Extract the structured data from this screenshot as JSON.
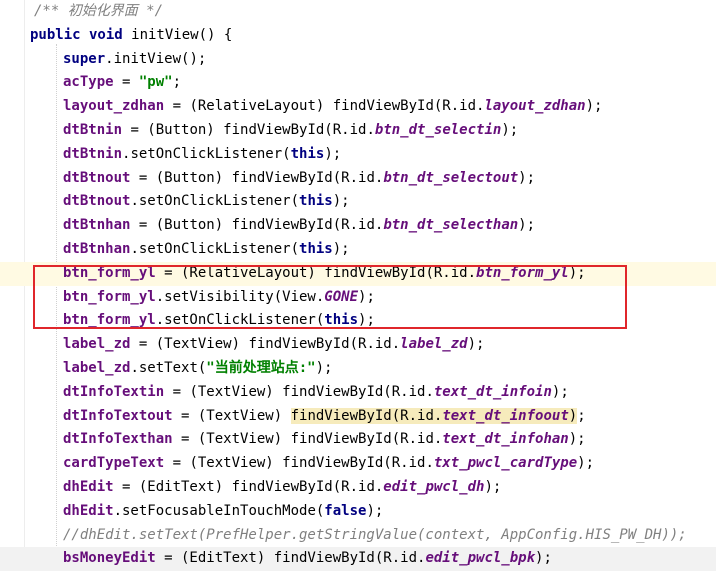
{
  "editor": {
    "lines": [
      [
        {
          "t": "/** 初始化界面 */",
          "c": "cm"
        }
      ],
      [
        {
          "t": "public void",
          "c": "kw"
        },
        {
          "t": " initView() {",
          "c": ""
        }
      ],
      [
        {
          "t": "super",
          "c": "kw"
        },
        {
          "t": ".initView();",
          "c": ""
        }
      ],
      [
        {
          "t": "acType",
          "c": "fld"
        },
        {
          "t": " = ",
          "c": ""
        },
        {
          "t": "\"pw\"",
          "c": "str"
        },
        {
          "t": ";",
          "c": ""
        }
      ],
      [
        {
          "t": "layout_zdhan",
          "c": "fld"
        },
        {
          "t": " = (RelativeLayout) findViewById(R.id.",
          "c": ""
        },
        {
          "t": "layout_zdhan",
          "c": "sfld"
        },
        {
          "t": ");",
          "c": ""
        }
      ],
      [
        {
          "t": "dtBtnin",
          "c": "fld"
        },
        {
          "t": " = (Button) findViewById(R.id.",
          "c": ""
        },
        {
          "t": "btn_dt_selectin",
          "c": "sfld"
        },
        {
          "t": ");",
          "c": ""
        }
      ],
      [
        {
          "t": "dtBtnin",
          "c": "fld"
        },
        {
          "t": ".setOnClickListener(",
          "c": ""
        },
        {
          "t": "this",
          "c": "kw"
        },
        {
          "t": ");",
          "c": ""
        }
      ],
      [
        {
          "t": "dtBtnout",
          "c": "fld"
        },
        {
          "t": " = (Button) findViewById(R.id.",
          "c": ""
        },
        {
          "t": "btn_dt_selectout",
          "c": "sfld"
        },
        {
          "t": ");",
          "c": ""
        }
      ],
      [
        {
          "t": "dtBtnout",
          "c": "fld"
        },
        {
          "t": ".setOnClickListener(",
          "c": ""
        },
        {
          "t": "this",
          "c": "kw"
        },
        {
          "t": ");",
          "c": ""
        }
      ],
      [
        {
          "t": "dtBtnhan",
          "c": "fld"
        },
        {
          "t": " = (Button) findViewById(R.id.",
          "c": ""
        },
        {
          "t": "btn_dt_selecthan",
          "c": "sfld"
        },
        {
          "t": ");",
          "c": ""
        }
      ],
      [
        {
          "t": "dtBtnhan",
          "c": "fld"
        },
        {
          "t": ".setOnClickListener(",
          "c": ""
        },
        {
          "t": "this",
          "c": "kw"
        },
        {
          "t": ");",
          "c": ""
        }
      ],
      [
        {
          "t": "btn_form_yl",
          "c": "fld"
        },
        {
          "t": " = (RelativeLayout) findViewById(R.id.",
          "c": ""
        },
        {
          "t": "btn_form_yl",
          "c": "sfld"
        },
        {
          "t": ");",
          "c": ""
        }
      ],
      [
        {
          "t": "btn_form_yl",
          "c": "fld"
        },
        {
          "t": ".setVisibility(View.",
          "c": ""
        },
        {
          "t": "GONE",
          "c": "sfld"
        },
        {
          "t": ");",
          "c": ""
        }
      ],
      [
        {
          "t": "btn_form_yl",
          "c": "fld"
        },
        {
          "t": ".setOnClickListener(",
          "c": ""
        },
        {
          "t": "this",
          "c": "kw"
        },
        {
          "t": ");",
          "c": ""
        }
      ],
      [
        {
          "t": "label_zd",
          "c": "fld"
        },
        {
          "t": " = (TextView) findViewById(R.id.",
          "c": ""
        },
        {
          "t": "label_zd",
          "c": "sfld"
        },
        {
          "t": ");",
          "c": ""
        }
      ],
      [
        {
          "t": "label_zd",
          "c": "fld"
        },
        {
          "t": ".setText(",
          "c": ""
        },
        {
          "t": "\"当前处理站点:\"",
          "c": "str"
        },
        {
          "t": ");",
          "c": ""
        }
      ],
      [
        {
          "t": "dtInfoTextin",
          "c": "fld"
        },
        {
          "t": " = (TextView) findViewById(R.id.",
          "c": ""
        },
        {
          "t": "text_dt_infoin",
          "c": "sfld"
        },
        {
          "t": ");",
          "c": ""
        }
      ],
      [
        {
          "t": "dtInfoTextout",
          "c": "fld"
        },
        {
          "t": " = (TextView) ",
          "c": ""
        },
        {
          "t": "findViewById(R.id.",
          "c": "hl"
        },
        {
          "t": "text_dt_infoout",
          "c": "sfld hl"
        },
        {
          "t": ")",
          "c": "hl"
        },
        {
          "t": ";",
          "c": ""
        }
      ],
      [
        {
          "t": "dtInfoTexthan",
          "c": "fld"
        },
        {
          "t": " = (TextView) findViewById(R.id.",
          "c": ""
        },
        {
          "t": "text_dt_infohan",
          "c": "sfld"
        },
        {
          "t": ");",
          "c": ""
        }
      ],
      [
        {
          "t": "cardTypeText",
          "c": "fld"
        },
        {
          "t": " = (TextView) findViewById(R.id.",
          "c": ""
        },
        {
          "t": "txt_pwcl_cardType",
          "c": "sfld"
        },
        {
          "t": ");",
          "c": ""
        }
      ],
      [
        {
          "t": "dhEdit",
          "c": "fld"
        },
        {
          "t": " = (EditText) findViewById(R.id.",
          "c": ""
        },
        {
          "t": "edit_pwcl_dh",
          "c": "sfld"
        },
        {
          "t": ");",
          "c": ""
        }
      ],
      [
        {
          "t": "dhEdit",
          "c": "fld"
        },
        {
          "t": ".setFocusableInTouchMode(",
          "c": ""
        },
        {
          "t": "false",
          "c": "kw"
        },
        {
          "t": ");",
          "c": ""
        }
      ],
      [
        {
          "t": "//dhEdit.setText(PrefHelper.getStringValue(context, AppConfig.HIS_PW_DH));",
          "c": "cm"
        }
      ],
      [
        {
          "t": "bsMoneyEdit",
          "c": "fld"
        },
        {
          "t": " = (EditText) findViewById(R.id.",
          "c": ""
        },
        {
          "t": "edit_pwcl_bpk",
          "c": "sfld"
        },
        {
          "t": ");",
          "c": ""
        }
      ]
    ]
  }
}
